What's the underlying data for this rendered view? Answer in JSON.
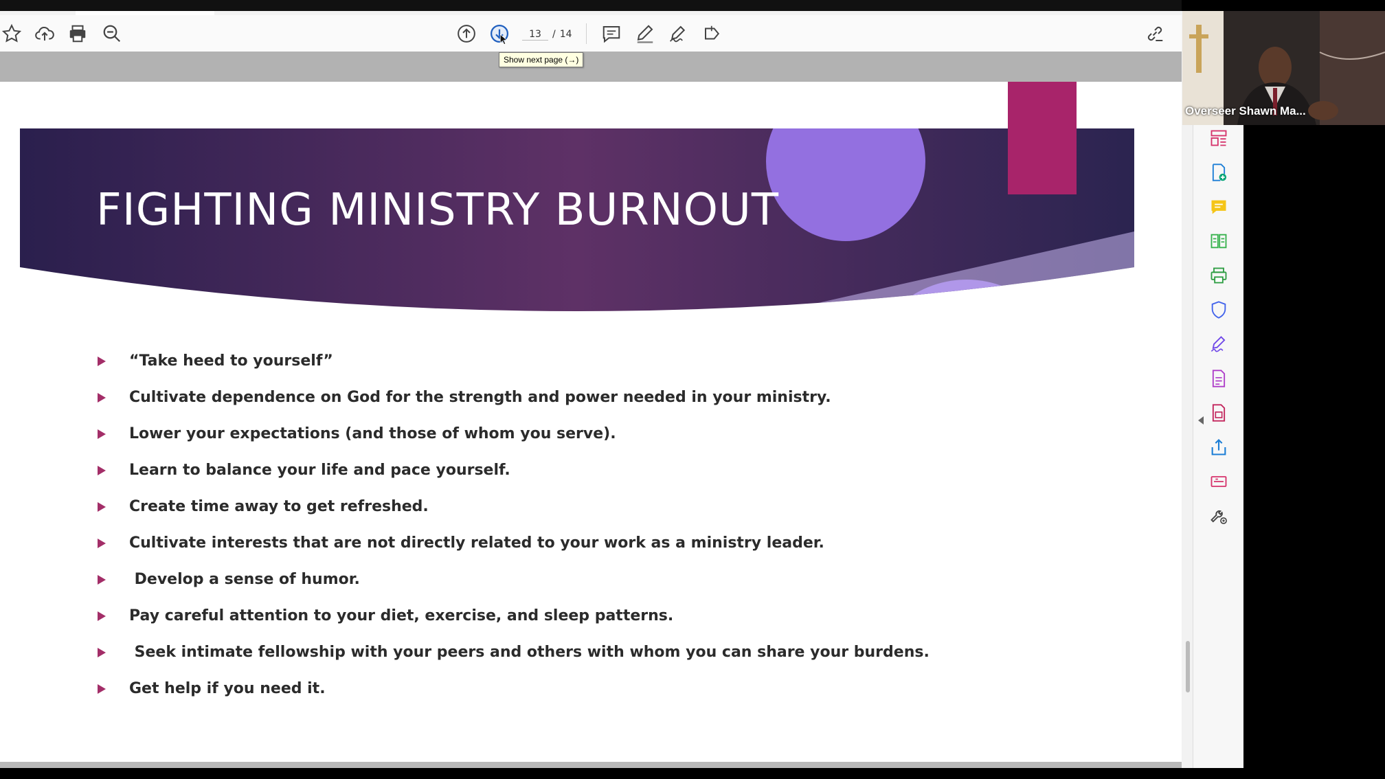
{
  "toolbar": {
    "page_current": "13",
    "page_separator": "/",
    "page_total": "14",
    "tooltip": "Show next page (→)",
    "left_icons": [
      "star-icon",
      "cloud-upload-icon",
      "print-icon",
      "zoom-out-icon"
    ],
    "nav_icons": [
      "previous-page-icon",
      "next-page-icon"
    ],
    "tool_icons": [
      "comment-icon",
      "highlight-pen-icon",
      "sign-icon",
      "stamp-icon"
    ],
    "right_icons": [
      "share-link-icon"
    ]
  },
  "slide": {
    "title": "FIGHTING MINISTRY BURNOUT",
    "bullets": [
      "“Take heed to yourself”",
      "Cultivate dependence on God for the strength and power needed in your ministry.",
      "Lower your expectations (and those of whom you serve).",
      "Learn to balance your life and pace yourself.",
      "Create time away to get refreshed.",
      "Cultivate interests that are not directly related to your work as a ministry leader.",
      " Develop a sense of humor.",
      "Pay careful attention to your diet, exercise, and sleep patterns.",
      " Seek intimate fellowship with your peers and others with whom you can share your burdens.",
      "Get help if you need it."
    ],
    "colors": {
      "banner_dark": "#2a1f4d",
      "banner_mid": "#5e3166",
      "circle": "#9370e0",
      "accent": "#a8246a",
      "bullet_arrow": "#a32e68"
    }
  },
  "right_panel": {
    "tools": [
      "organize-pages-icon",
      "create-pdf-icon",
      "comment-tool-icon",
      "compare-icon",
      "print-production-icon",
      "protect-shield-icon",
      "fill-sign-icon",
      "export-pdf-icon",
      "edit-pdf-icon",
      "share-icon",
      "scan-icon",
      "more-tools-icon"
    ]
  },
  "video": {
    "participant_name": "Overseer Shawn Ma..."
  }
}
